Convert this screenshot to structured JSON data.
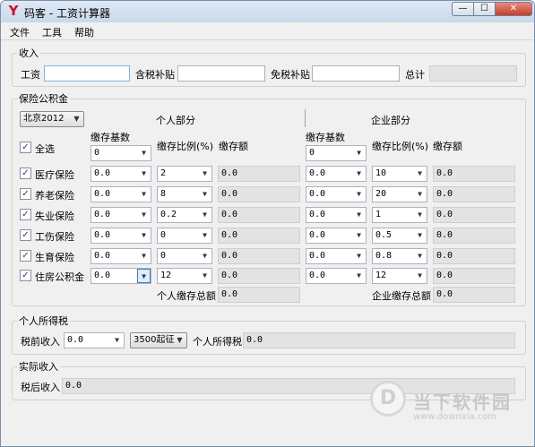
{
  "window": {
    "icon": "Y",
    "title": "码客 - 工资计算器",
    "controls": {
      "min": "—",
      "max": "☐",
      "close": "✕"
    }
  },
  "menu": [
    "文件",
    "工具",
    "帮助"
  ],
  "income": {
    "legend": "收入",
    "salary_label": "工资",
    "salary_value": "",
    "taxable_allowance_label": "含税补贴",
    "taxable_allowance_value": "",
    "taxfree_allowance_label": "免税补贴",
    "taxfree_allowance_value": "",
    "total_label": "总计",
    "total_value": ""
  },
  "insurance": {
    "legend": "保险公积金",
    "city": "北京2012",
    "personal_header": "个人部分",
    "company_header": "企业部分",
    "select_all_label": "全选",
    "base_header": "缴存基数",
    "ratio_header": "缴存比例(%)",
    "amount_header": "缴存额",
    "personal_base_top": "0",
    "company_base_top": "0",
    "rows": [
      {
        "label": "医疗保险",
        "p_base": "0.0",
        "p_ratio": "2",
        "p_amount": "0.0",
        "c_base": "0.0",
        "c_ratio": "10",
        "c_amount": "0.0"
      },
      {
        "label": "养老保险",
        "p_base": "0.0",
        "p_ratio": "8",
        "p_amount": "0.0",
        "c_base": "0.0",
        "c_ratio": "20",
        "c_amount": "0.0"
      },
      {
        "label": "失业保险",
        "p_base": "0.0",
        "p_ratio": "0.2",
        "p_amount": "0.0",
        "c_base": "0.0",
        "c_ratio": "1",
        "c_amount": "0.0"
      },
      {
        "label": "工伤保险",
        "p_base": "0.0",
        "p_ratio": "0",
        "p_amount": "0.0",
        "c_base": "0.0",
        "c_ratio": "0.5",
        "c_amount": "0.0"
      },
      {
        "label": "生育保险",
        "p_base": "0.0",
        "p_ratio": "0",
        "p_amount": "0.0",
        "c_base": "0.0",
        "c_ratio": "0.8",
        "c_amount": "0.0"
      },
      {
        "label": "住房公积金",
        "p_base": "0.0",
        "p_ratio": "12",
        "p_amount": "0.0",
        "c_base": "0.0",
        "c_ratio": "12",
        "c_amount": "0.0"
      }
    ],
    "personal_total_label": "个人缴存总额",
    "personal_total_value": "0.0",
    "company_total_label": "企业缴存总额",
    "company_total_value": "0.0"
  },
  "tax": {
    "legend": "个人所得税",
    "pretax_label": "税前收入",
    "pretax_value": "0.0",
    "threshold": "3500起征",
    "tax_label": "个人所得税",
    "tax_value": "0.0"
  },
  "actual": {
    "legend": "实际收入",
    "aftertax_label": "税后收入",
    "aftertax_value": "0.0"
  },
  "watermark": {
    "logo": "D",
    "text": "当下软件园",
    "url": "www.downxia.com"
  }
}
